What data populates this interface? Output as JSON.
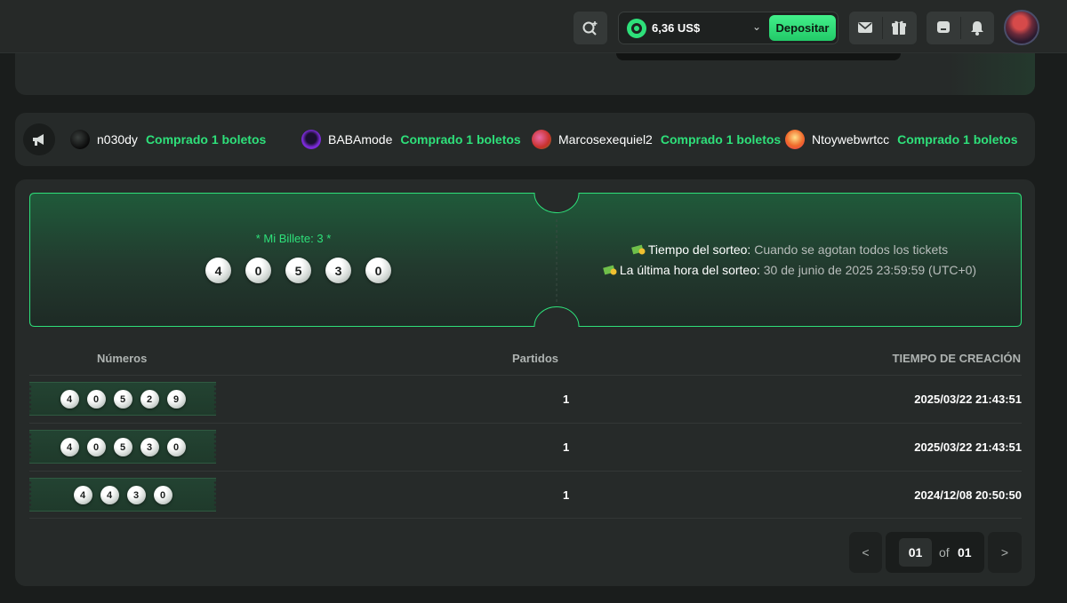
{
  "header": {
    "balance": "6,36 US$",
    "deposit_label": "Depositar"
  },
  "ticker": {
    "items": [
      {
        "name": "n030dy",
        "action": "Comprado 1 boletos"
      },
      {
        "name": "BABAmode",
        "action": "Comprado 1 boletos"
      },
      {
        "name": "Marcosexequiel2",
        "action": "Comprado 1 boletos"
      },
      {
        "name": "Ntoywebwrtcc",
        "action": "Comprado 1 boletos"
      }
    ]
  },
  "ticket": {
    "my_ticket": "* Mi Billete: 3 *",
    "numbers": [
      "4",
      "0",
      "5",
      "3",
      "0"
    ],
    "draw_time_label": "Tiempo del sorteo:",
    "draw_time_value": "Cuando se agotan todos los tickets",
    "last_draw_label": "La última hora del sorteo:",
    "last_draw_value": "30 de junio de 2025 23:59:59 (UTC+0)"
  },
  "table": {
    "headers": {
      "numbers": "Números",
      "matches": "Partidos",
      "created": "TIEMPO DE CREACIÓN"
    },
    "rows": [
      {
        "numbers": [
          "4",
          "0",
          "5",
          "2",
          "9"
        ],
        "matches": "1",
        "created": "2025/03/22 21:43:51"
      },
      {
        "numbers": [
          "4",
          "0",
          "5",
          "3",
          "0"
        ],
        "matches": "1",
        "created": "2025/03/22 21:43:51"
      },
      {
        "numbers": [
          "4",
          "4",
          "3",
          "0"
        ],
        "matches": "1",
        "created": "2024/12/08 20:50:50"
      }
    ]
  },
  "pagination": {
    "prev": "<",
    "current": "01",
    "of": "of",
    "total": "01",
    "next": ">"
  },
  "colors": {
    "accent": "#2ee07a",
    "background": "#1a1d1c",
    "panel": "#262a29"
  }
}
